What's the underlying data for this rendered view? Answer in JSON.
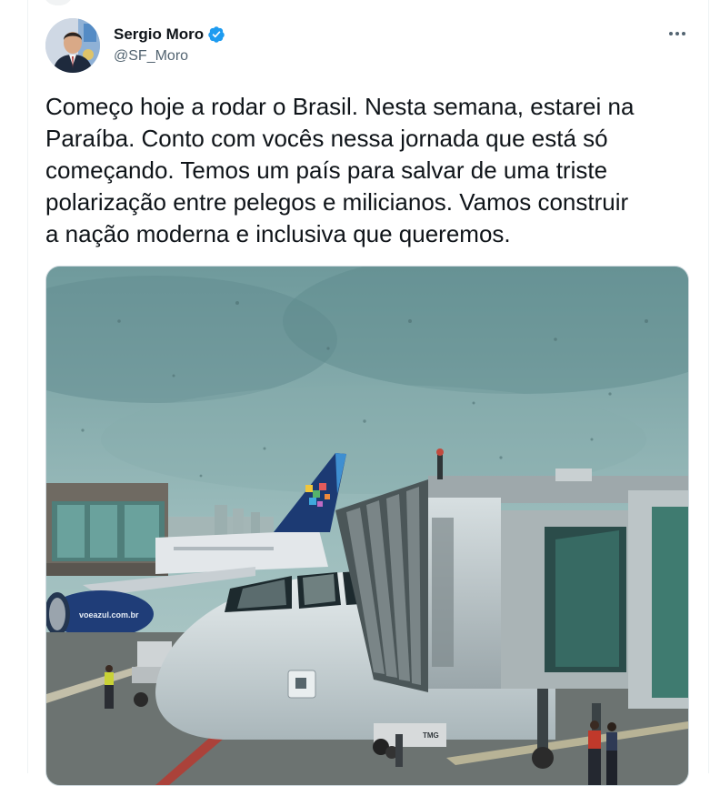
{
  "author": {
    "name": "Sergio Moro",
    "handle": "@SF_Moro",
    "verified": true
  },
  "tweet": {
    "text": "Começo hoje a rodar o Brasil. Nesta semana, estarei na\nParaíba. Conto com vocês nessa jornada que está só\ncomeçando. Temos um país para salvar de uma triste\npolarização entre pelegos e milicianos. Vamos construir\na nação moderna e inclusiva que queremos."
  },
  "media": {
    "engine_text": "voeazul.com.br",
    "tug_text": "TMG"
  },
  "colors": {
    "verified": "#1d9bf0",
    "text_primary": "#0f1419",
    "text_secondary": "#536471",
    "border": "#cfd9de"
  },
  "icons": {
    "more": "more-horizontal-icon",
    "verified": "verified-badge-icon"
  }
}
